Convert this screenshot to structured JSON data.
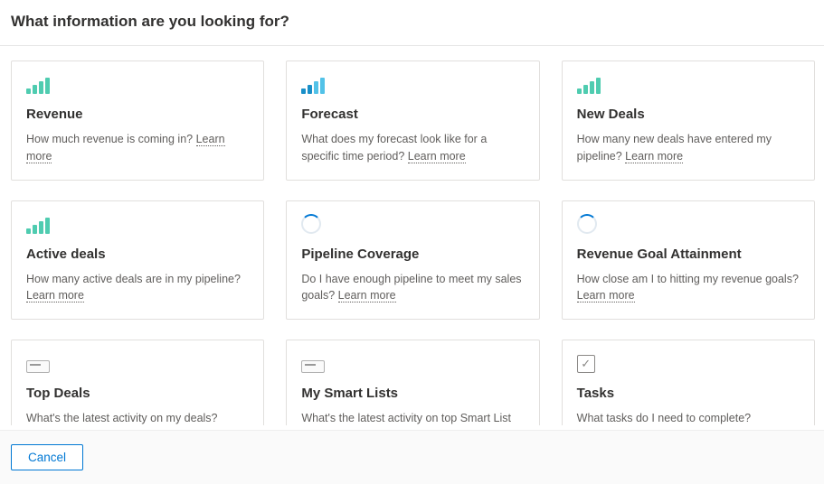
{
  "header": {
    "title": "What information are you looking for?"
  },
  "learn_more_label": "Learn more",
  "cards": [
    {
      "icon": "bars-green",
      "title": "Revenue",
      "desc": "How much revenue is coming in? ",
      "learn_more": true
    },
    {
      "icon": "bars-blue",
      "title": "Forecast",
      "desc": "What does my forecast look like for a specific time period? ",
      "learn_more": true
    },
    {
      "icon": "bars-green",
      "title": "New Deals",
      "desc": "How many new deals have entered my pipeline? ",
      "learn_more": true
    },
    {
      "icon": "bars-green",
      "title": "Active deals",
      "desc": "How many active deals are in my pipeline? ",
      "learn_more": true
    },
    {
      "icon": "spinner",
      "title": "Pipeline Coverage",
      "desc": "Do I have enough pipeline to meet my sales goals? ",
      "learn_more": true
    },
    {
      "icon": "spinner",
      "title": "Revenue Goal Attainment",
      "desc": "How close am I to hitting my revenue goals? ",
      "learn_more": true
    },
    {
      "icon": "list",
      "title": "Top Deals",
      "desc": "What's the latest activity on my deals? ",
      "learn_more": true
    },
    {
      "icon": "list",
      "title": "My Smart Lists",
      "desc": "What's the latest activity on top Smart List items?",
      "learn_more": false
    },
    {
      "icon": "check",
      "title": "Tasks",
      "desc": "What tasks do I need to complete?",
      "learn_more": false
    }
  ],
  "footer": {
    "cancel_label": "Cancel"
  }
}
